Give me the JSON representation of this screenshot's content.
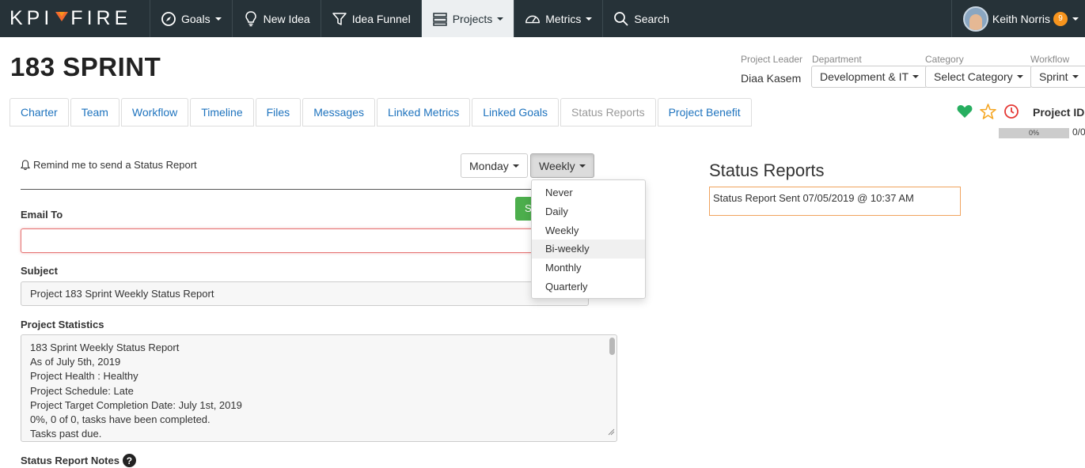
{
  "nav": {
    "logo_left": "KPI",
    "logo_right": "FIRE",
    "items": [
      {
        "label": "Goals",
        "icon": "compass-icon",
        "caret": true
      },
      {
        "label": "New Idea",
        "icon": "lightbulb-icon",
        "caret": false
      },
      {
        "label": "Idea Funnel",
        "icon": "funnel-icon",
        "caret": false
      },
      {
        "label": "Projects",
        "icon": "projects-icon",
        "caret": true,
        "active": true
      },
      {
        "label": "Metrics",
        "icon": "gauge-icon",
        "caret": true
      },
      {
        "label": "Search",
        "icon": "search-icon",
        "caret": false
      }
    ],
    "user_name": "Keith Norris",
    "notification_count": "9"
  },
  "header": {
    "title": "183 SPRINT",
    "project_leader_label": "Project Leader",
    "project_leader_value": "Diaa Kasem",
    "department_label": "Department",
    "department_value": "Development & IT",
    "category_label": "Category",
    "category_value": "Select Category",
    "workflow_label": "Workflow",
    "workflow_value": "Sprint"
  },
  "tabs": [
    "Charter",
    "Team",
    "Workflow",
    "Timeline",
    "Files",
    "Messages",
    "Linked Metrics",
    "Linked Goals",
    "Status Reports",
    "Project Benefit"
  ],
  "active_tab": "Status Reports",
  "project_id_label": "Project ID:",
  "progress": {
    "percent": 0,
    "label": "0%",
    "count_text": "0/0"
  },
  "colors": {
    "nav_bg": "#263238",
    "link": "#1e73be",
    "accent_orange": "#f26a2e",
    "heart": "#27ae60",
    "star": "#f5a623",
    "clock": "#e53935",
    "highlight_border": "#f0a35e"
  },
  "form": {
    "reminder_text": "Remind me to send a Status Report",
    "day_select": "Monday",
    "frequency_select": "Weekly",
    "send_button_partial": "S",
    "email_label": "Email To",
    "email_value": "",
    "subject_label": "Subject",
    "subject_value": "Project 183 Sprint Weekly Status Report",
    "stats_label": "Project Statistics",
    "stats_lines": [
      "183 Sprint Weekly Status Report",
      "As of July 5th, 2019",
      "Project Health : Healthy",
      "Project Schedule: Late",
      "Project Target Completion Date: July 1st, 2019",
      "0%, 0 of 0, tasks have been completed.",
      "Tasks past due."
    ],
    "notes_label": "Status Report Notes"
  },
  "frequency_menu": {
    "options": [
      "Never",
      "Daily",
      "Weekly",
      "Bi-weekly",
      "Monthly",
      "Quarterly"
    ],
    "hovered": "Bi-weekly"
  },
  "status_reports": {
    "title": "Status Reports",
    "entries": [
      "Status Report Sent 07/05/2019 @ 10:37 AM"
    ]
  }
}
